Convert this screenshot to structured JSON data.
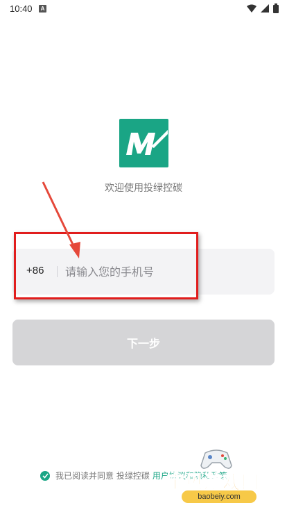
{
  "status_bar": {
    "time": "10:40",
    "notification_badge": "A"
  },
  "app": {
    "welcome_text": "欢迎使用投绿控碳",
    "brand_color": "#1aa585"
  },
  "phone_field": {
    "country_code": "+86",
    "placeholder": "请输入您的手机号"
  },
  "next_button": {
    "label": "下一步"
  },
  "agreement": {
    "prefix": "我已阅读并同意 投绿控碳",
    "link": "用户协议和隐私政策"
  },
  "watermark": {
    "text": "宝贝游戏网",
    "url": "baobeiy.com"
  },
  "annotation": {
    "highlight_color": "#e11d1d"
  }
}
